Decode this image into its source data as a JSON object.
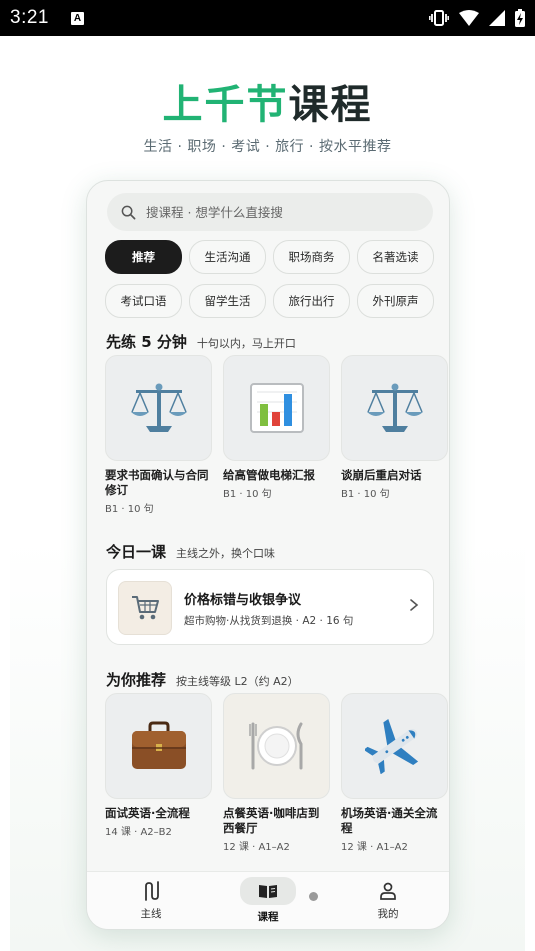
{
  "status_bar": {
    "time": "3:21",
    "notification_badge": "A"
  },
  "hero": {
    "title_green": "上千节",
    "title_dark": "课程",
    "subtitle": "生活 · 职场 · 考试 · 旅行 · 按水平推荐"
  },
  "search": {
    "placeholder": "搜课程 · 想学什么直接搜"
  },
  "chips": [
    {
      "label": "推荐",
      "active": true
    },
    {
      "label": "生活沟通"
    },
    {
      "label": "职场商务"
    },
    {
      "label": "名著选读"
    },
    {
      "label": "考试口语"
    },
    {
      "label": "留学生活"
    },
    {
      "label": "旅行出行"
    },
    {
      "label": "外刊原声"
    }
  ],
  "practice": {
    "title": "先练 5 分钟",
    "subtitle": "十句以内，马上开口",
    "cards": [
      {
        "name": "要求书面确认与合同修订",
        "meta": "B1 · 10 句",
        "icon": "scales-icon"
      },
      {
        "name": "给高管做电梯汇报",
        "meta": "B1 · 10 句",
        "icon": "bar-chart-icon"
      },
      {
        "name": "谈崩后重启对话",
        "meta": "B1 · 10 句",
        "icon": "scales-icon"
      }
    ]
  },
  "daily": {
    "title": "今日一课",
    "subtitle": "主线之外，换个口味",
    "lesson_title": "价格标错与收银争议",
    "lesson_meta": "超市购物·从找货到退换 · A2 · 16 句",
    "icon": "shopping-cart-icon"
  },
  "recommend": {
    "title": "为你推荐",
    "subtitle": "按主线等级 L2（约 A2）",
    "cards": [
      {
        "name": "面试英语·全流程",
        "meta": "14 课 · A2–B2",
        "icon": "briefcase-icon"
      },
      {
        "name": "点餐英语·咖啡店到西餐厅",
        "meta": "12 课 · A1–A2",
        "icon": "plate-cutlery-icon"
      },
      {
        "name": "机场英语·通关全流程",
        "meta": "12 课 · A1–A2",
        "icon": "airplane-icon"
      }
    ]
  },
  "tabbar": {
    "items": [
      {
        "label": "主线",
        "icon": "route-icon"
      },
      {
        "label": "课程",
        "icon": "book-icon",
        "active": true
      },
      {
        "label": "我的",
        "icon": "person-icon"
      }
    ]
  },
  "colors": {
    "brand_green": "#21b374",
    "dark": "#1f2a2a",
    "chip_active": "#1c1c1c"
  }
}
